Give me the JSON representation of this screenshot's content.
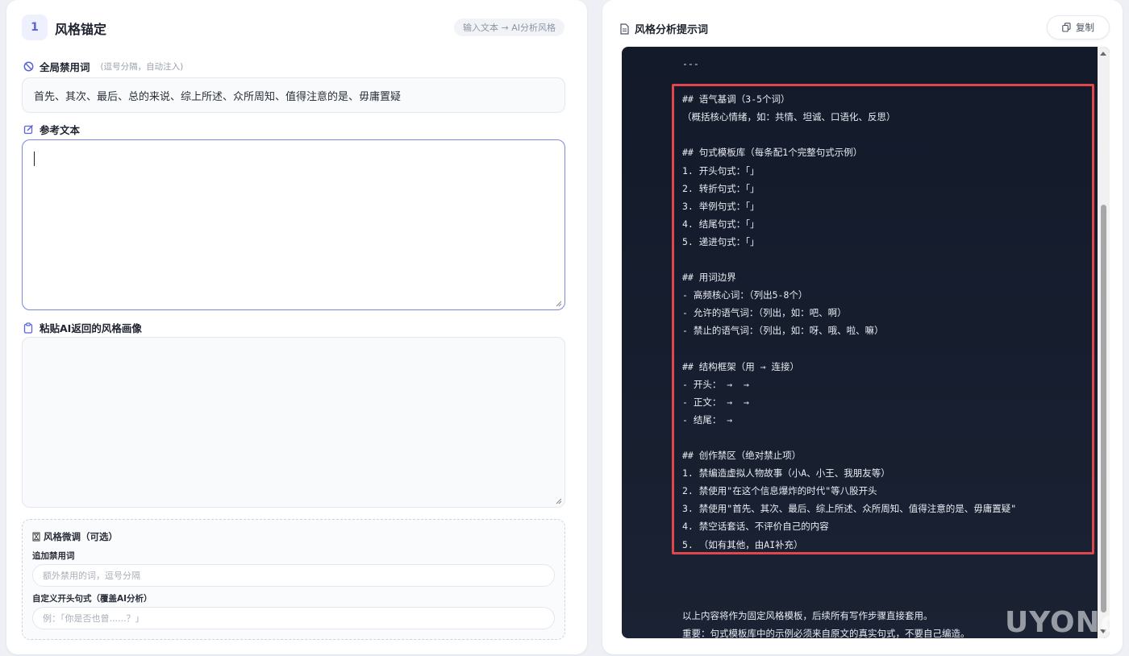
{
  "left": {
    "step_number": "1",
    "step_title": "风格锚定",
    "hint_pill": "输入文本 → AI分析风格",
    "forbidden": {
      "label": "全局禁用词",
      "sublabel": "(逗号分隔，自动注入)",
      "value": "首先、其次、最后、总的来说、综上所述、众所周知、值得注意的是、毋庸置疑"
    },
    "reference": {
      "label": "参考文本",
      "value": ""
    },
    "portrait": {
      "label": "粘贴AI返回的风格画像",
      "value": ""
    },
    "finetune": {
      "title": "风格微调（可选）",
      "extra_label": "追加禁用词",
      "extra_placeholder": "额外禁用的词，逗号分隔",
      "opening_label": "自定义开头句式（覆盖AI分析）",
      "opening_placeholder": "例：「你是否也曾......？」"
    }
  },
  "right": {
    "title": "风格分析提示词",
    "copy_label": "复制",
    "code_lines": [
      "---",
      "",
      "## 语气基调（3-5个词）",
      "（概括核心情绪，如：共情、坦诚、口语化、反思）",
      "",
      "## 句式模板库（每条配1个完整句式示例）",
      "1. 开头句式：「」",
      "2. 转折句式：「」",
      "3. 举例句式：「」",
      "4. 结尾句式：「」",
      "5. 递进句式：「」",
      "",
      "## 用词边界",
      "- 高频核心词：（列出5-8个）",
      "- 允许的语气词：（列出，如：吧、啊）",
      "- 禁止的语气词：（列出，如：呀、哦、啦、嘛）",
      "",
      "## 结构框架（用 → 连接）",
      "- 开头： →  →",
      "- 正文： →  →",
      "- 结尾： →",
      "",
      "## 创作禁区（绝对禁止项）",
      "1. 禁编造虚拟人物故事（小A、小王、我朋友等）",
      "2. 禁使用\"在这个信息爆炸的时代\"等八股开头",
      "3. 禁使用\"首先、其次、最后、综上所述、众所周知、值得注意的是、毋庸置疑\"",
      "4. 禁空话套话、不评价自己的内容",
      "5. （如有其他，由AI补充）",
      "",
      "",
      "",
      "以上内容将作为固定风格模板，后续所有写作步骤直接套用。",
      "重要：句式模板库中的示例必须来自原文的真实句式，不要自己编造。"
    ],
    "watermark": "UYONo"
  },
  "colors": {
    "accent": "#5a63d8",
    "highlight": "#e0474c",
    "code_bg": "#131a2a"
  }
}
